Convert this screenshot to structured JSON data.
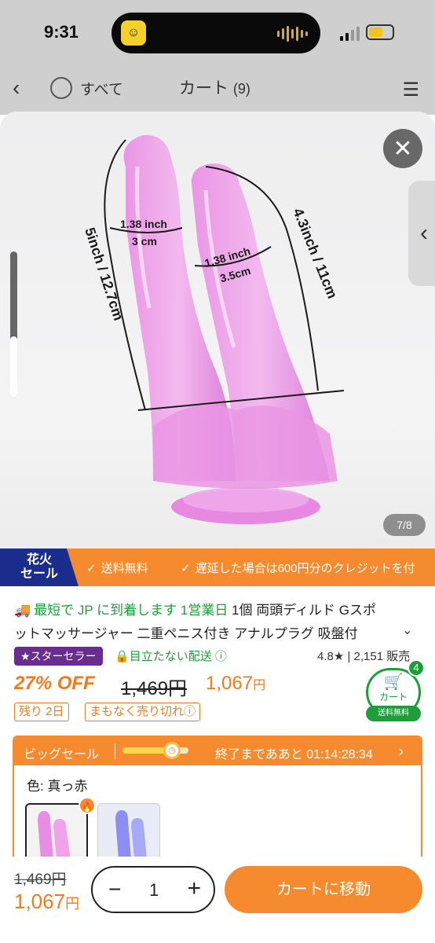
{
  "status_bar": {
    "time": "9:31"
  },
  "header": {
    "select_all": "すべて",
    "title": "カート",
    "count": "(9)"
  },
  "gallery": {
    "counter": "7/8",
    "labels": {
      "left_width_in": "1.38 inch",
      "left_width_cm": "3 cm",
      "right_width_in": "1.38 inch",
      "right_width_cm": "3.5cm",
      "left_length": "5inch / 12.7cm",
      "right_length": "4.3inch / 11cm"
    }
  },
  "promo": {
    "badge_line1": "花火",
    "badge_line2": "セール",
    "item1": "送料無料",
    "item2": "遅延した場合は600円分のクレジットを付"
  },
  "product": {
    "delivery": "最短で JP に到着します 1営業日",
    "title_rest": " 1個 両頭ディルド Gスポ",
    "title_line2": "ットマッサージャー 二重ペニス付き アナルプラグ 吸盤付",
    "star_seller": "スターセラー",
    "discreet": "目立たない配送",
    "rating": "4.8",
    "sold": "2,151 販売",
    "discount": "27% OFF",
    "original_price": "1,469円",
    "sale_price": "1,067",
    "sale_unit": "円",
    "tag_left": "残り 2日",
    "tag_soon": "まもなく売り切れ"
  },
  "cart_fab": {
    "badge": "4",
    "label": "カート",
    "free_shipping": "送料無料"
  },
  "big_sale": {
    "label": "ビッグセール",
    "progress_fraction": 0.75,
    "countdown": "終了までああと 01:14:28:34",
    "color_label": "色: 真っ赤"
  },
  "bottom": {
    "original": "1,469円",
    "sale": "1,067",
    "sale_unit": "円",
    "quantity": "1",
    "go_cart": "カートに移動"
  },
  "colors": {
    "accent": "#f58b2e",
    "green": "#1e9e3a",
    "purple": "#6a2c8f"
  }
}
